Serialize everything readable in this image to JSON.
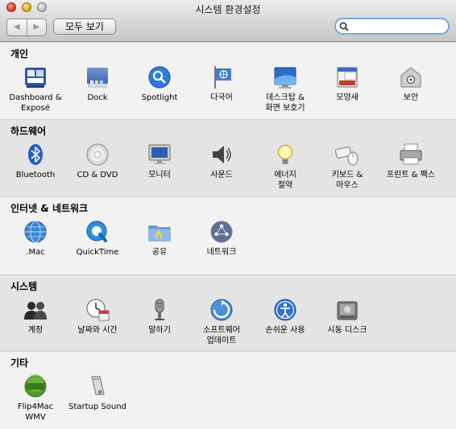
{
  "window": {
    "title": "시스템 환경설정"
  },
  "toolbar": {
    "back": "◀",
    "forward": "▶",
    "show_all": "모두 보기",
    "search_value": ""
  },
  "sections": [
    {
      "title": "개인",
      "items": [
        {
          "name": "dashboard-expose",
          "label": "Dashboard &\nExposé"
        },
        {
          "name": "dock",
          "label": "Dock"
        },
        {
          "name": "spotlight",
          "label": "Spotlight"
        },
        {
          "name": "international",
          "label": "다국어"
        },
        {
          "name": "desktop-screensaver",
          "label": "데스크탑 &\n화면 보호기"
        },
        {
          "name": "appearance",
          "label": "모양새"
        },
        {
          "name": "security",
          "label": "보안"
        }
      ]
    },
    {
      "title": "하드웨어",
      "items": [
        {
          "name": "bluetooth",
          "label": "Bluetooth"
        },
        {
          "name": "cd-dvd",
          "label": "CD & DVD"
        },
        {
          "name": "displays",
          "label": "모니터"
        },
        {
          "name": "sound",
          "label": "사운드"
        },
        {
          "name": "energy-saver",
          "label": "에너지\n절약"
        },
        {
          "name": "keyboard-mouse",
          "label": "키보드 &\n마우스"
        },
        {
          "name": "print-fax",
          "label": "프린트 & 팩스"
        }
      ]
    },
    {
      "title": "인터넷 & 네트워크",
      "items": [
        {
          "name": "mac",
          "label": ".Mac"
        },
        {
          "name": "quicktime",
          "label": "QuickTime"
        },
        {
          "name": "sharing",
          "label": "공유"
        },
        {
          "name": "network",
          "label": "네트워크"
        }
      ]
    },
    {
      "title": "시스템",
      "items": [
        {
          "name": "accounts",
          "label": "계정"
        },
        {
          "name": "date-time",
          "label": "날짜와 시간"
        },
        {
          "name": "speech",
          "label": "말하기"
        },
        {
          "name": "software-update",
          "label": "소프트웨어\n업데이트"
        },
        {
          "name": "universal-access",
          "label": "손쉬운 사용"
        },
        {
          "name": "startup-disk",
          "label": "시동 디스크"
        }
      ]
    },
    {
      "title": "기타",
      "items": [
        {
          "name": "flip4mac",
          "label": "Flip4Mac\nWMV"
        },
        {
          "name": "startup-sound",
          "label": "Startup Sound"
        }
      ]
    }
  ]
}
